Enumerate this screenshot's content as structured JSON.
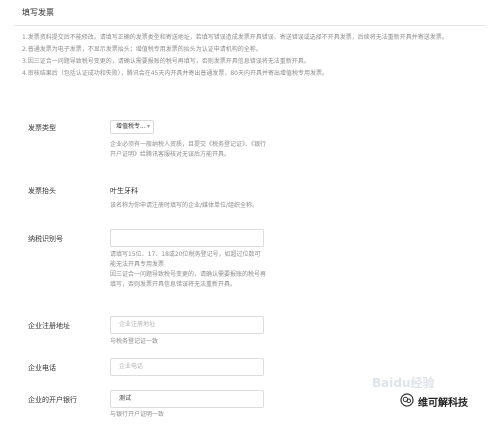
{
  "section_title": "填写发票",
  "notice": [
    "1.发票资料提交后不能修改。请填写正确的发票类型和寄送地址，若填写错误造成发票开具错误、寄送错误或选择不开具发票，后续将无法重新开具并寄送发票。",
    "2.普通发票为电子发票，不显示发票抬头；增值税专用发票的抬头为认证申请机构的全称。",
    "3.因三证合一问题导致税号变更的，请确认需要报账的税号再填写，否则发票开具信息错误将无法重新开具。",
    "4.审核结果后（包括认证成功和失败），腾讯会在45天内开具并寄出普通发票，80天内开具并寄出增值税专用发票。"
  ],
  "form": {
    "invoice_type": {
      "label": "发票类型",
      "selected": "增值税专...",
      "hint": "企业必须有一般纳税人资质，且提交《税务登记证》、《银行开户证明》给腾讯客服核对无误后方能开具。"
    },
    "invoice_title": {
      "label": "发票抬头",
      "value": "叶生牙科",
      "hint": "该名称为你申请注册时填写的企业/媒体单位/组织全称。"
    },
    "tax_id": {
      "label": "纳税识别号",
      "value": "",
      "hint": [
        "请填写15位、17、18或20位税务登记号，如超过位数可能无法开具专用发票",
        "因三证合一问题导致税号变更的，请确认需要报账的税号再填写，否则发票开具信息错误将无法重新开具。"
      ]
    },
    "reg_address": {
      "label": "企业注册地址",
      "placeholder": "企业注册地址",
      "hint": "与税务登记证一致"
    },
    "phone": {
      "label": "企业电话",
      "placeholder": "企业电话"
    },
    "bank": {
      "label": "企业的开户银行",
      "value": "测试",
      "hint": "与银行开户证明一致"
    }
  },
  "watermark": {
    "logo_text": "Baidu经验",
    "brand": "维可解科技",
    "icon": "wechat-official-account-icon"
  },
  "colors": {
    "text": "#333333",
    "hint": "#8c8c8c",
    "border": "#d9d9d9"
  }
}
